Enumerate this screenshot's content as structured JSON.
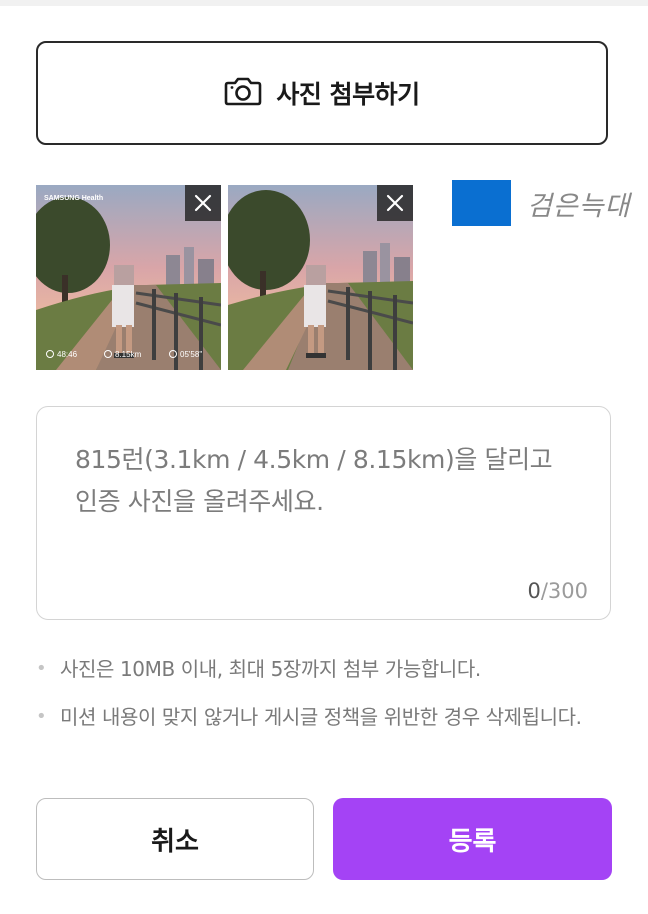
{
  "attach": {
    "label": "사진 첨부하기",
    "icon": "camera-icon"
  },
  "photos": [
    {
      "overlay_brand": "SAMSUNG Health",
      "stats": [
        "48:46",
        "8.15km",
        "05'58\""
      ],
      "close_icon": "close-icon"
    },
    {
      "close_icon": "close-icon"
    }
  ],
  "nickname": {
    "text": "검은늑대",
    "swatch_color": "#0a6fd1"
  },
  "textarea": {
    "placeholder": "815런(3.1km / 4.5km / 8.15km)을 달리고 인증 사진을 올려주세요.",
    "count": "0",
    "max": "/300"
  },
  "notices": [
    "사진은 10MB 이내, 최대 5장까지 첨부 가능합니다.",
    "미션 내용이 맞지 않거나 게시글 정책을 위반한 경우 삭제됩니다."
  ],
  "buttons": {
    "cancel": "취소",
    "submit": "등록"
  },
  "colors": {
    "accent": "#a443f5",
    "border": "#2a2a2a"
  }
}
